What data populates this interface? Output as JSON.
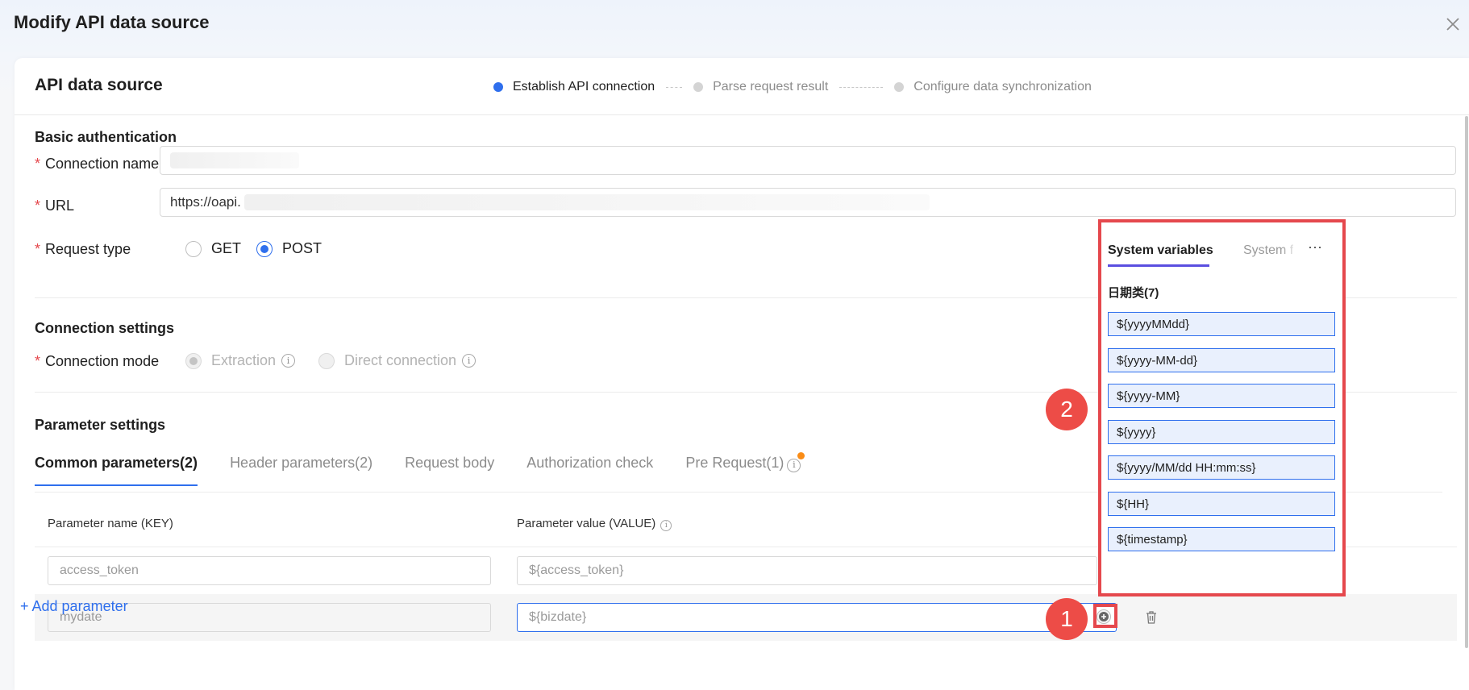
{
  "modal": {
    "title": "Modify API data source"
  },
  "card": {
    "title": "API data source"
  },
  "steps": [
    {
      "label": "Establish API connection",
      "state": "active"
    },
    {
      "label": "Parse request result",
      "state": "pending"
    },
    {
      "label": "Configure data synchronization",
      "state": "pending"
    }
  ],
  "basic_auth": {
    "title": "Basic authentication",
    "connection_name_label": "Connection name",
    "url_label": "URL",
    "url_value": "https://oapi.",
    "request_type_label": "Request type",
    "request_types": [
      "GET",
      "POST"
    ],
    "request_type_selected": "POST"
  },
  "connection_settings": {
    "title": "Connection settings",
    "mode_label": "Connection mode",
    "modes": [
      "Extraction",
      "Direct connection"
    ],
    "mode_selected": "Extraction"
  },
  "parameter_settings": {
    "title": "Parameter settings",
    "tabs": [
      {
        "label": "Common parameters(2)"
      },
      {
        "label": "Header parameters(2)"
      },
      {
        "label": "Request body"
      },
      {
        "label": "Authorization check"
      },
      {
        "label": "Pre Request(1)"
      }
    ],
    "columns": {
      "key": "Parameter name (KEY)",
      "value": "Parameter value (VALUE)"
    },
    "rows": [
      {
        "key": "access_token",
        "value": "${access_token}"
      },
      {
        "key": "mydate",
        "value": "${bizdate}"
      }
    ],
    "add_label": "+ Add parameter"
  },
  "popover": {
    "tabs": [
      "System variables",
      "System f"
    ],
    "more": "···",
    "category": "日期类(7)",
    "variables": [
      "${yyyyMMdd}",
      "${yyyy-MM-dd}",
      "${yyyy-MM}",
      "${yyyy}",
      "${yyyy/MM/dd HH:mm:ss}",
      "${HH}",
      "${timestamp}"
    ]
  },
  "markers": [
    "1",
    "2"
  ],
  "colors": {
    "accent": "#2f6fed",
    "annotation": "#e5484d",
    "required": "#e5484d"
  }
}
